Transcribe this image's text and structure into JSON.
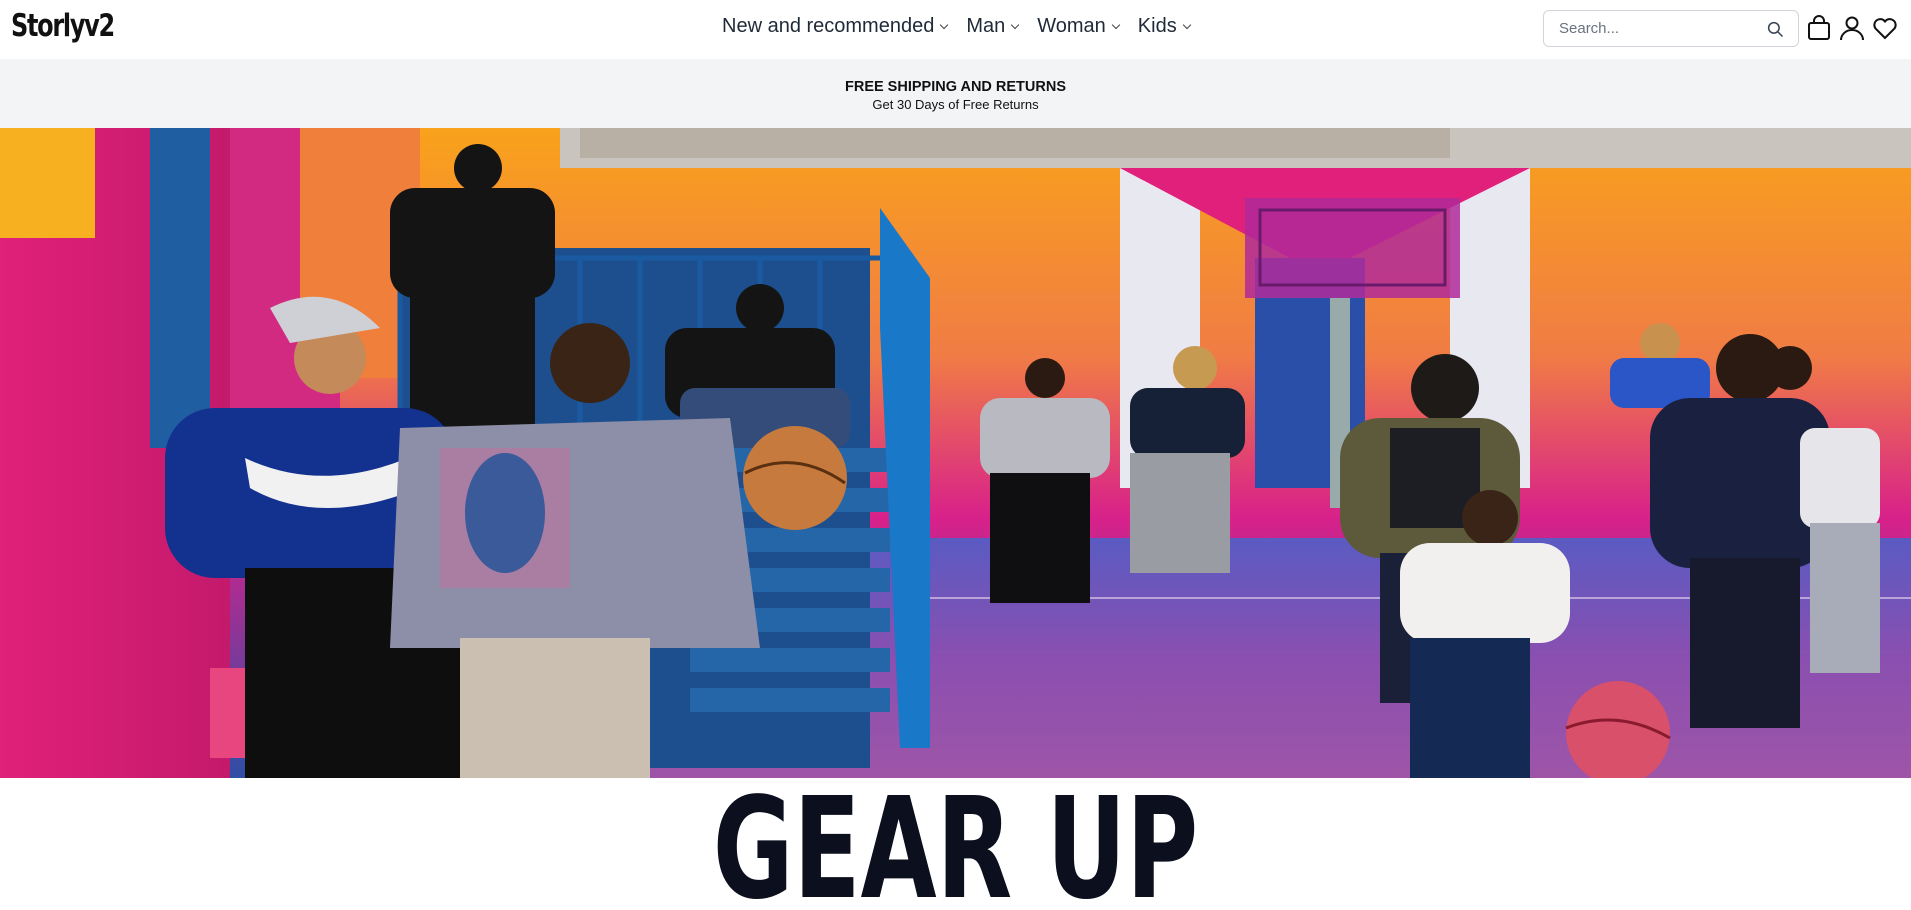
{
  "header": {
    "logo": "Storlyv2",
    "nav": [
      {
        "label": "New and recommended"
      },
      {
        "label": "Man"
      },
      {
        "label": "Woman"
      },
      {
        "label": "Kids"
      }
    ],
    "search": {
      "placeholder": "Search..."
    },
    "icons": [
      "search-icon",
      "shopping-bag-icon",
      "user-icon",
      "heart-icon"
    ]
  },
  "promo": {
    "title": "FREE SHIPPING AND RETURNS",
    "subtitle": "Get 30 Days of Free Returns"
  },
  "hero": {
    "headline": "GEAR UP"
  },
  "colors": {
    "accent_pink": "#e0207a",
    "accent_orange": "#f7a51a",
    "court_purple": "#7a55b0",
    "text_dark": "#0b0f1e",
    "banner_bg": "#f3f4f6"
  }
}
